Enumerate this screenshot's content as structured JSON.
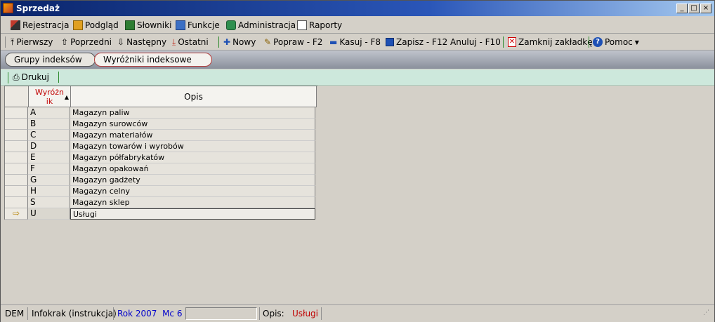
{
  "window": {
    "title": "Sprzedaż"
  },
  "window_controls": {
    "minimize": "_",
    "maximize": "□",
    "close": "×"
  },
  "menu": [
    {
      "label": "Rejestracja",
      "icon": "registration-icon"
    },
    {
      "label": "Podgląd",
      "icon": "preview-icon"
    },
    {
      "label": "Słowniki",
      "icon": "dictionary-icon"
    },
    {
      "label": "Funkcje",
      "icon": "functions-icon"
    },
    {
      "label": "Administracja",
      "icon": "administration-icon"
    },
    {
      "label": "Raporty",
      "icon": "reports-icon"
    }
  ],
  "toolbar": {
    "first": "Pierwszy",
    "previous": "Poprzedni",
    "next": "Następny",
    "last": "Ostatni",
    "new": "Nowy",
    "edit": "Popraw - F2",
    "delete": "Kasuj - F8",
    "save": "Zapisz - F12",
    "cancel": "Anuluj - F10",
    "close_tab": "Zamknij zakładkę",
    "help": "Pomoc"
  },
  "tabs": [
    {
      "label": "Grupy indeksów",
      "active": false
    },
    {
      "label": "Wyróżniki indeksowe",
      "active": true
    }
  ],
  "grid_toolbar": {
    "print": "Drukuj"
  },
  "grid": {
    "columns": {
      "code_line1": "Wyróżn",
      "code_line2": "ik",
      "description": "Opis"
    },
    "rows": [
      {
        "code": "A",
        "description": "Magazyn paliw"
      },
      {
        "code": "B",
        "description": "Magazyn surowców"
      },
      {
        "code": "C",
        "description": "Magazyn materiałów"
      },
      {
        "code": "D",
        "description": "Magazyn towarów i wyrobów"
      },
      {
        "code": "E",
        "description": "Magazyn półfabrykatów"
      },
      {
        "code": "F",
        "description": "Magazyn opakowań"
      },
      {
        "code": "G",
        "description": "Magazyn gadżety"
      },
      {
        "code": "H",
        "description": "Magazyn celny"
      },
      {
        "code": "S",
        "description": "Magazyn sklep"
      },
      {
        "code": "U",
        "description": "Usługi"
      }
    ],
    "current_row_index": 9
  },
  "status": {
    "db": "DEM",
    "user": "Infokrak (instrukcja)",
    "period": "Rok 2007  Mc 6",
    "desc_label": "Opis:",
    "desc_value": "Usługi"
  },
  "colors": {
    "title_start": "#0a246a",
    "title_end": "#a6caf0",
    "period": "#0000cc",
    "desc_value": "#c00000",
    "accent": "#2e8b2e"
  }
}
